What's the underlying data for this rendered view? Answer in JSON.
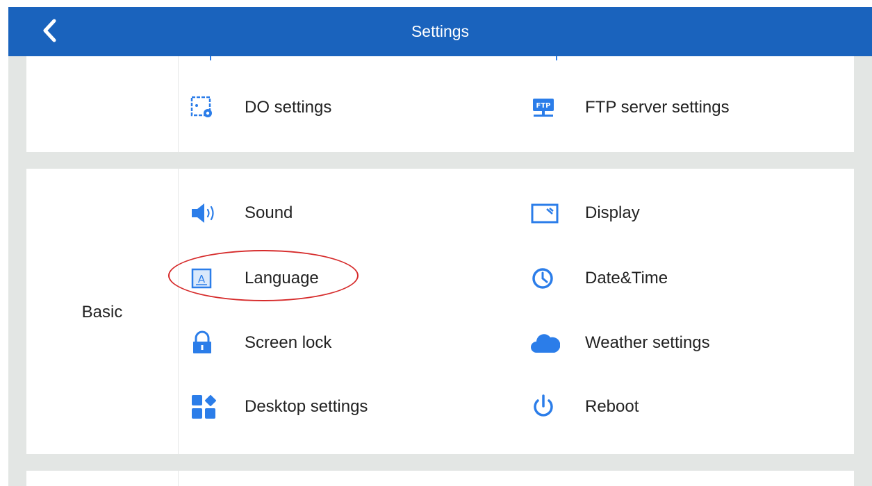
{
  "header": {
    "title": "Settings",
    "back_icon": "chevron-left-icon"
  },
  "colors": {
    "accent": "#1a63bd",
    "icon_blue": "#2b7de9",
    "background": "#e3e6e4",
    "highlight_annotation": "#d62b2b"
  },
  "sections": {
    "top": {
      "label": "",
      "items": [
        {
          "label": "DO settings",
          "icon": "do-settings-icon"
        },
        {
          "label": "FTP server settings",
          "icon": "ftp-server-icon"
        }
      ]
    },
    "basic": {
      "label": "Basic",
      "items": [
        {
          "label": "Sound",
          "icon": "speaker-icon"
        },
        {
          "label": "Display",
          "icon": "display-icon"
        },
        {
          "label": "Language",
          "icon": "language-icon"
        },
        {
          "label": "Date&Time",
          "icon": "clock-icon"
        },
        {
          "label": "Screen lock",
          "icon": "lock-icon"
        },
        {
          "label": "Weather settings",
          "icon": "cloud-icon"
        },
        {
          "label": "Desktop settings",
          "icon": "apps-grid-icon"
        },
        {
          "label": "Reboot",
          "icon": "power-icon"
        }
      ]
    }
  }
}
